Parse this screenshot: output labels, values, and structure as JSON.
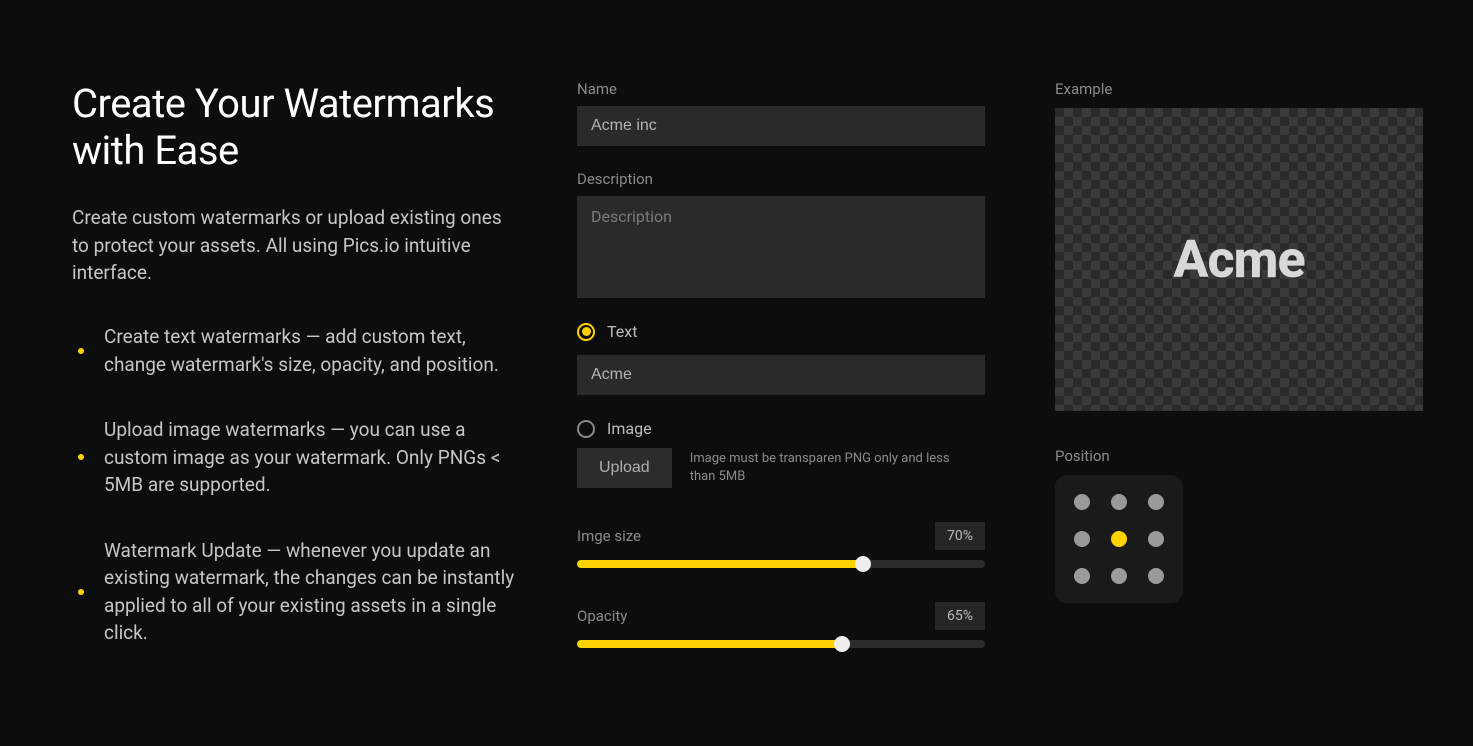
{
  "left": {
    "title": "Create Your Watermarks with Ease",
    "subtitle": "Create custom watermarks or upload existing ones to protect your assets. All using Pics.io intuitive interface.",
    "bullets": [
      "Create text watermarks — add custom text, change watermark's size, opacity, and position.",
      "Upload image watermarks — you can use a custom image as your watermark. Only PNGs < 5MB are supported.",
      "Watermark Update — whenever you update an existing watermark, the changes can be instantly applied to all of your existing assets in a single click."
    ]
  },
  "form": {
    "name_label": "Name",
    "name_value": "Acme inc",
    "description_label": "Description",
    "description_placeholder": "Description",
    "description_value": "",
    "type": {
      "text_label": "Text",
      "text_selected": true,
      "text_value": "Acme",
      "image_label": "Image",
      "image_selected": false
    },
    "upload_button": "Upload",
    "upload_hint": "Image must be transparen PNG only and less than 5MB",
    "sliders": {
      "size": {
        "label": "Imge size",
        "value_text": "70%",
        "percent": 70
      },
      "opacity": {
        "label": "Opacity",
        "value_text": "65%",
        "percent": 65
      }
    }
  },
  "right": {
    "example_label": "Example",
    "example_text": "Acme",
    "position_label": "Position",
    "position_selected_index": 4
  }
}
